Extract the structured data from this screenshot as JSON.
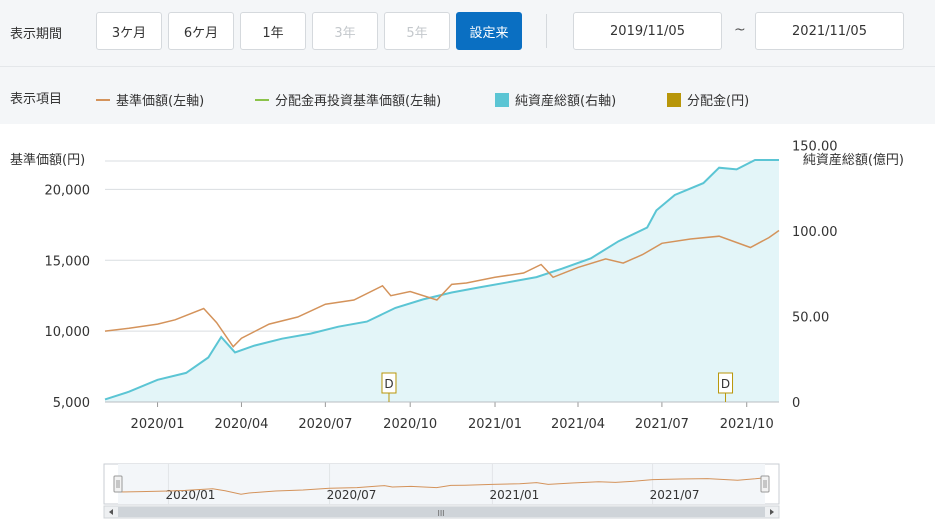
{
  "controls": {
    "period_label": "表示期間",
    "buttons": [
      {
        "label": "3ケ月",
        "state": "normal"
      },
      {
        "label": "6ケ月",
        "state": "normal"
      },
      {
        "label": "1年",
        "state": "normal"
      },
      {
        "label": "3年",
        "state": "disabled"
      },
      {
        "label": "5年",
        "state": "disabled"
      },
      {
        "label": "設定来",
        "state": "active"
      }
    ],
    "date_from": "2019/11/05",
    "date_separator": "~",
    "date_to": "2021/11/05"
  },
  "legend": {
    "label": "表示項目",
    "items": [
      {
        "label": "基準価額(左軸)",
        "color": "#d4935b",
        "kind": "line"
      },
      {
        "label": "分配金再投資基準価額(左軸)",
        "color": "#8bc34a",
        "kind": "line"
      },
      {
        "label": "純資産総額(右軸)",
        "color": "#5bc5d4",
        "kind": "box"
      },
      {
        "label": "分配金(円)",
        "color": "#b8960a",
        "kind": "box"
      }
    ]
  },
  "chart_data": {
    "type": "line",
    "left_axis_title": "基準価額(円)",
    "right_axis_title": "純資産総額(億円)",
    "left_ylim": [
      5000,
      22500
    ],
    "left_ticks": [
      "5,000",
      "10,000",
      "15,000",
      "20,000"
    ],
    "right_ylim": [
      0,
      145
    ],
    "right_ticks": [
      "0",
      "50.00",
      "100.00",
      "150.00"
    ],
    "x_range": [
      "2019-11-05",
      "2021-11-05"
    ],
    "x_ticks": [
      "2020/01",
      "2020/04",
      "2020/07",
      "2020/10",
      "2021/01",
      "2021/04",
      "2021/07",
      "2021/10"
    ],
    "series": [
      {
        "name": "基準価額(左軸)",
        "color": "#d4935b",
        "points": [
          [
            "2019-11-05",
            10000
          ],
          [
            "2019-12-01",
            10200
          ],
          [
            "2020-01-01",
            10500
          ],
          [
            "2020-01-20",
            10800
          ],
          [
            "2020-02-20",
            11600
          ],
          [
            "2020-03-05",
            10600
          ],
          [
            "2020-03-23",
            8900
          ],
          [
            "2020-04-01",
            9500
          ],
          [
            "2020-05-01",
            10500
          ],
          [
            "2020-06-01",
            11000
          ],
          [
            "2020-07-01",
            11900
          ],
          [
            "2020-08-01",
            12200
          ],
          [
            "2020-09-01",
            13200
          ],
          [
            "2020-09-10",
            12500
          ],
          [
            "2020-10-01",
            12800
          ],
          [
            "2020-10-30",
            12200
          ],
          [
            "2020-11-15",
            13300
          ],
          [
            "2020-12-01",
            13400
          ],
          [
            "2021-01-01",
            13800
          ],
          [
            "2021-02-01",
            14100
          ],
          [
            "2021-02-20",
            14700
          ],
          [
            "2021-03-05",
            13800
          ],
          [
            "2021-04-01",
            14500
          ],
          [
            "2021-05-01",
            15100
          ],
          [
            "2021-05-20",
            14800
          ],
          [
            "2021-06-10",
            15400
          ],
          [
            "2021-07-01",
            16200
          ],
          [
            "2021-08-01",
            16500
          ],
          [
            "2021-09-01",
            16700
          ],
          [
            "2021-10-05",
            15900
          ],
          [
            "2021-10-25",
            16600
          ],
          [
            "2021-11-05",
            17100
          ]
        ]
      },
      {
        "name": "純資産総額(右軸)",
        "color": "#5bc5d4",
        "points": [
          [
            "2019-11-05",
            1.5
          ],
          [
            "2019-12-01",
            6
          ],
          [
            "2020-01-01",
            13
          ],
          [
            "2020-02-01",
            17
          ],
          [
            "2020-02-25",
            26
          ],
          [
            "2020-03-10",
            38
          ],
          [
            "2020-03-25",
            29
          ],
          [
            "2020-04-15",
            33
          ],
          [
            "2020-05-15",
            37
          ],
          [
            "2020-06-15",
            40
          ],
          [
            "2020-07-15",
            44
          ],
          [
            "2020-08-15",
            47
          ],
          [
            "2020-09-15",
            55
          ],
          [
            "2020-10-15",
            60
          ],
          [
            "2020-11-15",
            64
          ],
          [
            "2020-12-15",
            67
          ],
          [
            "2021-01-15",
            70
          ],
          [
            "2021-02-15",
            73
          ],
          [
            "2021-03-15",
            78
          ],
          [
            "2021-04-15",
            84
          ],
          [
            "2021-05-15",
            94
          ],
          [
            "2021-06-15",
            102
          ],
          [
            "2021-06-25",
            112
          ],
          [
            "2021-07-15",
            121
          ],
          [
            "2021-08-15",
            128
          ],
          [
            "2021-09-01",
            137
          ],
          [
            "2021-09-20",
            136
          ],
          [
            "2021-10-10",
            145
          ],
          [
            "2021-10-25",
            148
          ],
          [
            "2021-11-05",
            155
          ]
        ]
      }
    ],
    "distributions": [
      {
        "date": "2020-09-08",
        "label": "D"
      },
      {
        "date": "2021-09-08",
        "label": "D"
      }
    ],
    "navigator": {
      "x_ticks": [
        "2020/01",
        "2020/07",
        "2021/01",
        "2021/07"
      ],
      "handle_glyph": "III"
    }
  }
}
